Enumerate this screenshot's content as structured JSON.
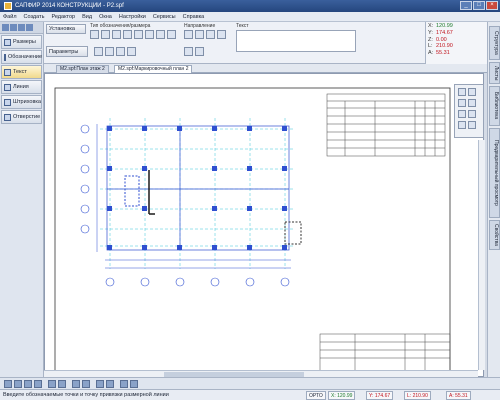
{
  "window": {
    "title": "САПФИР 2014 КОНСТРУКЦИИ - P2.spf"
  },
  "menu": [
    "Файл",
    "Создать",
    "Редактор",
    "Вид",
    "Окна",
    "Настройки",
    "Сервисы",
    "Справка"
  ],
  "left_panel": {
    "items": [
      {
        "label": "Размеры",
        "active": false
      },
      {
        "label": "Обозначение",
        "active": false
      },
      {
        "label": "Текст",
        "active": true
      },
      {
        "label": "Линия",
        "active": false
      },
      {
        "label": "Штриховка",
        "active": false
      },
      {
        "label": "Отверстие",
        "active": false
      }
    ]
  },
  "props": {
    "tab_label": "Установка",
    "params_label": "Параметры",
    "type_label": "Тип обозначения/размера",
    "direction_label": "Направление",
    "text_label": "Текст"
  },
  "coords": [
    {
      "axis": "X:",
      "value": "120.99"
    },
    {
      "axis": "Y:",
      "value": "174.67"
    },
    {
      "axis": "Z:",
      "value": "0.00"
    },
    {
      "axis": "L:",
      "value": "210.90"
    },
    {
      "axis": "A:",
      "value": "55.31"
    }
  ],
  "doc_tabs": [
    {
      "label": "M2.spf:План этаж 2",
      "active": false
    },
    {
      "label": "M2.spf:Маркировочный план 2",
      "active": true
    }
  ],
  "right_tabs": [
    "Структура",
    "Листы",
    "Библиотека",
    "Предварительный просмотр",
    "Свойства"
  ],
  "status": {
    "message": "Введите обозначаемые точки и точку привязки размерной линии",
    "fields": [
      {
        "label": "ОРТО",
        "value": ""
      },
      {
        "label": "X:",
        "value": "120.99"
      },
      {
        "label": "Y:",
        "value": "174.67"
      },
      {
        "label": "L:",
        "value": "210.90"
      },
      {
        "label": "A:",
        "value": "55.31"
      }
    ]
  },
  "colors": {
    "drawing_blue": "#2f4fd0",
    "grid_cyan": "#39c6d8",
    "red_values": "#c0141d"
  }
}
